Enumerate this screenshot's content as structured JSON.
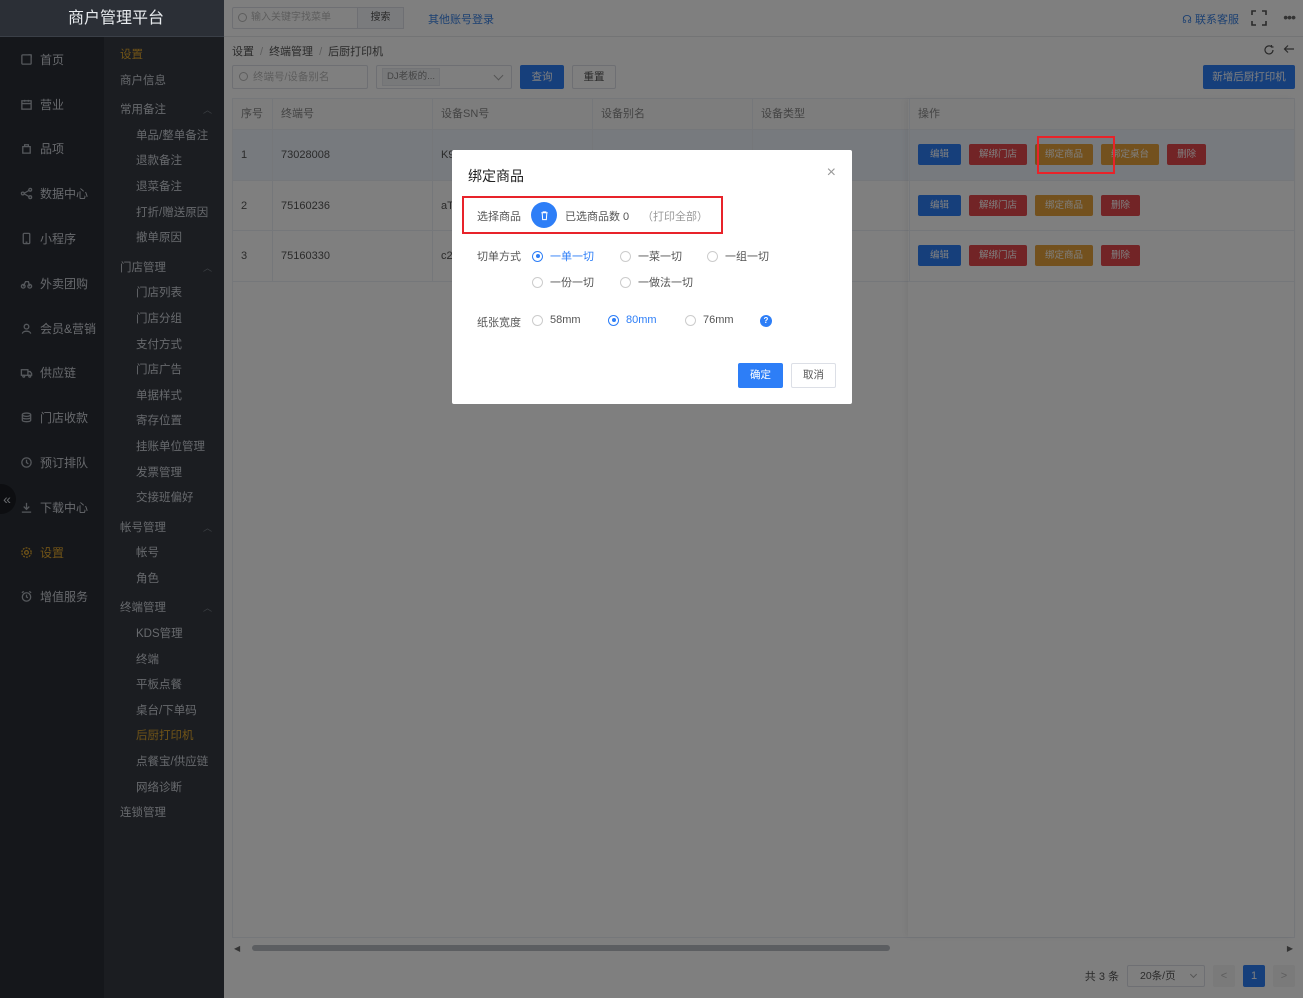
{
  "app": {
    "title": "商户管理平台"
  },
  "rail": {
    "items": [
      {
        "label": "首页",
        "icon": "home-icon"
      },
      {
        "label": "营业",
        "icon": "calendar-icon"
      },
      {
        "label": "品项",
        "icon": "bag-icon"
      },
      {
        "label": "数据中心",
        "icon": "share-icon"
      },
      {
        "label": "小程序",
        "icon": "phone-icon"
      },
      {
        "label": "外卖团购",
        "icon": "bike-icon"
      },
      {
        "label": "会员&营销",
        "icon": "user-icon"
      },
      {
        "label": "供应链",
        "icon": "truck-icon"
      },
      {
        "label": "门店收款",
        "icon": "coins-icon"
      },
      {
        "label": "预订排队",
        "icon": "clock-icon"
      },
      {
        "label": "下载中心",
        "icon": "download-icon"
      },
      {
        "label": "设置",
        "icon": "gear-icon",
        "active": true
      },
      {
        "label": "增值服务",
        "icon": "alarm-icon"
      }
    ]
  },
  "subnav": {
    "top": "设置",
    "merchant_info": "商户信息",
    "group1": {
      "label": "常用备注",
      "items": [
        "单品/整单备注",
        "退款备注",
        "退菜备注",
        "打折/赠送原因",
        "撤单原因"
      ]
    },
    "group2": {
      "label": "门店管理",
      "items": [
        "门店列表",
        "门店分组",
        "支付方式",
        "门店广告",
        "单据样式",
        "寄存位置",
        "挂账单位管理",
        "发票管理",
        "交接班偏好"
      ]
    },
    "group3": {
      "label": "帐号管理",
      "items": [
        "帐号",
        "角色"
      ]
    },
    "group4": {
      "label": "终端管理",
      "items": [
        "KDS管理",
        "终端",
        "平板点餐",
        "桌台/下单码",
        "后厨打印机",
        "点餐宝/供应链",
        "网络诊断"
      ]
    },
    "last": "连锁管理"
  },
  "topbar": {
    "search_placeholder": "输入关键字找菜单",
    "search_btn": "搜索",
    "other_login": "其他账号登录",
    "support": "联系客服",
    "more": "•••"
  },
  "breadcrumb": [
    "设置",
    "终端管理",
    "后厨打印机"
  ],
  "filters": {
    "terminal_placeholder": "终端号/设备别名",
    "store_tag": "DJ老板的...",
    "query": "查询",
    "reset": "重置",
    "new_printer": "新增后厨打印机"
  },
  "table": {
    "headers": [
      "序号",
      "终端号",
      "设备SN号",
      "设备别名",
      "设备类型",
      "操作"
    ],
    "rows": [
      {
        "idx": "1",
        "terminal": "73028008",
        "sn": "K9",
        "alias": "",
        "type": ""
      },
      {
        "idx": "2",
        "terminal": "75160236",
        "sn": "aT",
        "alias": "",
        "type": ""
      },
      {
        "idx": "3",
        "terminal": "75160330",
        "sn": "c2",
        "alias": "",
        "type": ""
      }
    ],
    "ops": {
      "edit": "编辑",
      "unbind_store": "解绑门店",
      "bind_goods": "绑定商品",
      "bind_table": "绑定桌台",
      "delete": "删除"
    }
  },
  "pager": {
    "total": "共 3 条",
    "size": "20条/页",
    "prev": "<",
    "current": "1",
    "next": ">"
  },
  "modal": {
    "title": "绑定商品",
    "close": "×",
    "select_goods_label": "选择商品",
    "selected_count": "已选商品数 0",
    "print_all": "（打印全部）",
    "cut_label": "切单方式",
    "cut_options": [
      "一单一切",
      "一菜一切",
      "一组一切",
      "一份一切",
      "一做法一切"
    ],
    "cut_selected": "一单一切",
    "paper_label": "纸张宽度",
    "paper_options": [
      "58mm",
      "80mm",
      "76mm"
    ],
    "paper_selected": "80mm",
    "help": "?",
    "confirm": "确定",
    "cancel": "取消"
  },
  "colors": {
    "primary": "#2d7ef7",
    "danger": "#e5484d",
    "warning": "#e6a23c",
    "highlight": "#e8232a",
    "active_nav": "#e0a72f"
  }
}
